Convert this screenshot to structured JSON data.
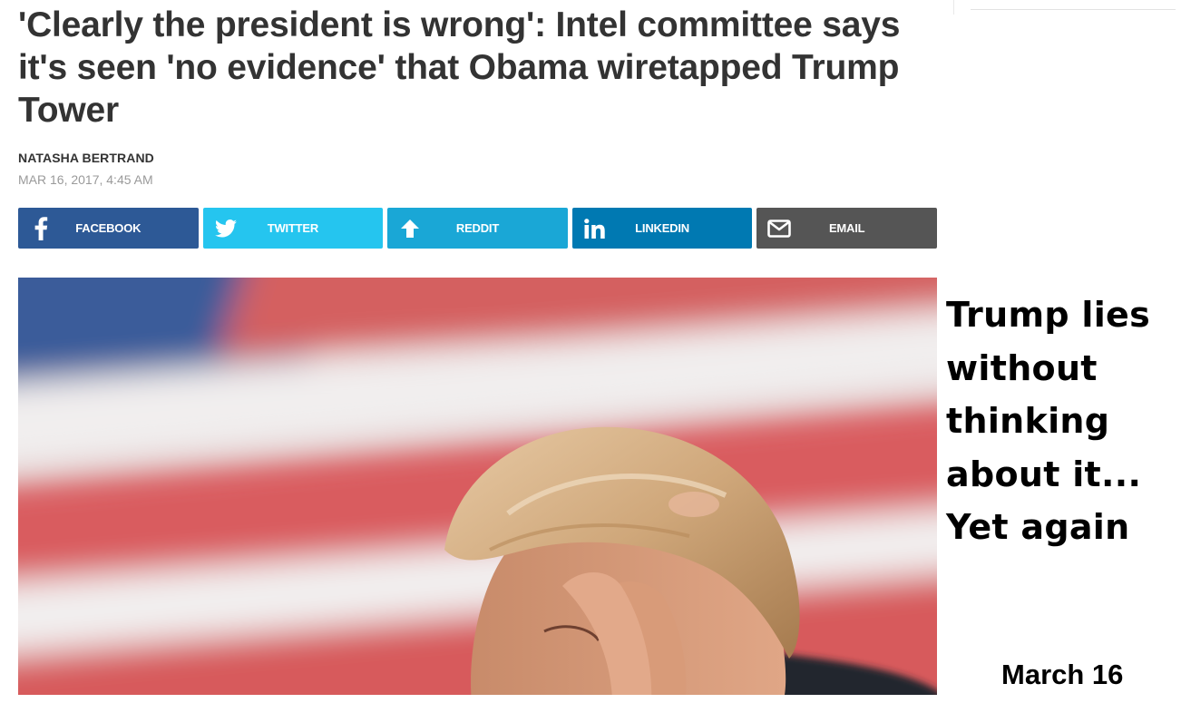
{
  "article": {
    "headline": "'Clearly the president is wrong': Intel committee says it's seen 'no evidence' that Obama wiretapped Trump Tower",
    "author": "NATASHA BERTRAND",
    "date": "MAR 16, 2017, 4:45 AM"
  },
  "share": {
    "facebook": {
      "label": "FACEBOOK",
      "icon": "facebook-f-icon",
      "color": "#2d5996"
    },
    "twitter": {
      "label": "TWITTER",
      "icon": "twitter-bird-icon",
      "color": "#25c5ef"
    },
    "reddit": {
      "label": "REDDIT",
      "icon": "up-arrow-icon",
      "color": "#1aa7d6"
    },
    "linkedin": {
      "label": "LINKEDIN",
      "icon": "linkedin-in-icon",
      "color": "#0079b2"
    },
    "email": {
      "label": "EMAIL",
      "icon": "envelope-icon",
      "color": "#555555"
    }
  },
  "hero_image": {
    "subject": "photo"
  },
  "overlay": {
    "caption": "Trump lies\nwithout\nthinking\nabout it...\nYet again",
    "date": "March 16"
  }
}
